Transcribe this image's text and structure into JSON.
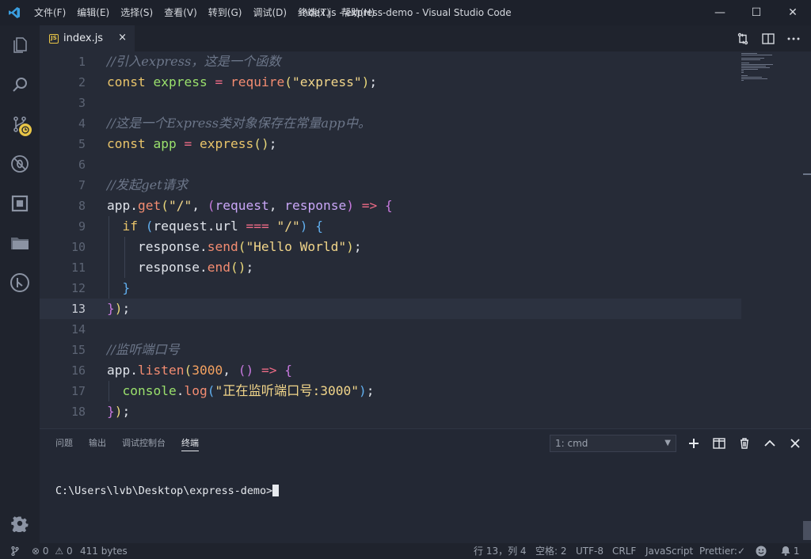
{
  "window": {
    "title": "index.js - express-demo - Visual Studio Code",
    "menu": [
      "文件(F)",
      "编辑(E)",
      "选择(S)",
      "查看(V)",
      "转到(G)",
      "调试(D)",
      "终端(T)",
      "帮助(H)"
    ],
    "controls": {
      "minimize": "—",
      "maximize": "☐",
      "close": "✕"
    }
  },
  "activity_bar": [
    "explorer-icon",
    "search-icon",
    "source-control-icon",
    "debug-icon",
    "extensions-icon",
    "folder-icon",
    "git-graph-icon",
    "gear-icon"
  ],
  "tab": {
    "badge": "JS",
    "label": "index.js",
    "close": "×"
  },
  "editor": {
    "current_line": 13,
    "lines": [
      {
        "n": "1",
        "tokens": [
          {
            "t": "//引入express，这是一个函数",
            "c": "c-comment"
          }
        ]
      },
      {
        "n": "2",
        "tokens": [
          {
            "t": "const",
            "c": "c-kw"
          },
          {
            "t": " ",
            "c": "c-plain"
          },
          {
            "t": "express",
            "c": "c-var"
          },
          {
            "t": " ",
            "c": "c-plain"
          },
          {
            "t": "=",
            "c": "c-op"
          },
          {
            "t": " ",
            "c": "c-plain"
          },
          {
            "t": "require",
            "c": "c-fn"
          },
          {
            "t": "(",
            "c": "c-paren"
          },
          {
            "t": "\"express\"",
            "c": "c-str"
          },
          {
            "t": ")",
            "c": "c-paren"
          },
          {
            "t": ";",
            "c": "c-plain"
          }
        ]
      },
      {
        "n": "3",
        "tokens": []
      },
      {
        "n": "4",
        "tokens": [
          {
            "t": "//这是一个Express类对象保存在常量app中。",
            "c": "c-comment"
          }
        ]
      },
      {
        "n": "5",
        "tokens": [
          {
            "t": "const",
            "c": "c-kw"
          },
          {
            "t": " ",
            "c": "c-plain"
          },
          {
            "t": "app",
            "c": "c-var"
          },
          {
            "t": " ",
            "c": "c-plain"
          },
          {
            "t": "=",
            "c": "c-op"
          },
          {
            "t": " ",
            "c": "c-plain"
          },
          {
            "t": "express",
            "c": "c-kw"
          },
          {
            "t": "()",
            "c": "c-paren"
          },
          {
            "t": ";",
            "c": "c-plain"
          }
        ]
      },
      {
        "n": "6",
        "tokens": []
      },
      {
        "n": "7",
        "tokens": [
          {
            "t": "//发起get请求",
            "c": "c-comment"
          }
        ]
      },
      {
        "n": "8",
        "tokens": [
          {
            "t": "app",
            "c": "c-plain"
          },
          {
            "t": ".",
            "c": "c-plain"
          },
          {
            "t": "get",
            "c": "c-fn"
          },
          {
            "t": "(",
            "c": "c-paren"
          },
          {
            "t": "\"/\"",
            "c": "c-str"
          },
          {
            "t": ", ",
            "c": "c-plain"
          },
          {
            "t": "(",
            "c": "c-paren2"
          },
          {
            "t": "request",
            "c": "c-param"
          },
          {
            "t": ", ",
            "c": "c-plain"
          },
          {
            "t": "response",
            "c": "c-param"
          },
          {
            "t": ")",
            "c": "c-paren2"
          },
          {
            "t": " ",
            "c": "c-plain"
          },
          {
            "t": "=>",
            "c": "c-op"
          },
          {
            "t": " ",
            "c": "c-plain"
          },
          {
            "t": "{",
            "c": "c-paren2"
          }
        ]
      },
      {
        "n": "9",
        "tokens": [
          {
            "t": "  ",
            "c": "c-plain"
          },
          {
            "t": "if",
            "c": "c-if"
          },
          {
            "t": " ",
            "c": "c-plain"
          },
          {
            "t": "(",
            "c": "c-paren3"
          },
          {
            "t": "request",
            "c": "c-plain"
          },
          {
            "t": ".url ",
            "c": "c-plain"
          },
          {
            "t": "===",
            "c": "c-op"
          },
          {
            "t": " ",
            "c": "c-plain"
          },
          {
            "t": "\"/\"",
            "c": "c-str"
          },
          {
            "t": ")",
            "c": "c-paren3"
          },
          {
            "t": " ",
            "c": "c-plain"
          },
          {
            "t": "{",
            "c": "c-paren3"
          }
        ]
      },
      {
        "n": "10",
        "tokens": [
          {
            "t": "    ",
            "c": "c-plain"
          },
          {
            "t": "response",
            "c": "c-plain"
          },
          {
            "t": ".",
            "c": "c-plain"
          },
          {
            "t": "send",
            "c": "c-fn"
          },
          {
            "t": "(",
            "c": "c-paren"
          },
          {
            "t": "\"Hello World\"",
            "c": "c-str"
          },
          {
            "t": ")",
            "c": "c-paren"
          },
          {
            "t": ";",
            "c": "c-plain"
          }
        ]
      },
      {
        "n": "11",
        "tokens": [
          {
            "t": "    ",
            "c": "c-plain"
          },
          {
            "t": "response",
            "c": "c-plain"
          },
          {
            "t": ".",
            "c": "c-plain"
          },
          {
            "t": "end",
            "c": "c-fn"
          },
          {
            "t": "()",
            "c": "c-paren"
          },
          {
            "t": ";",
            "c": "c-plain"
          }
        ]
      },
      {
        "n": "12",
        "tokens": [
          {
            "t": "  ",
            "c": "c-plain"
          },
          {
            "t": "}",
            "c": "c-paren3"
          }
        ]
      },
      {
        "n": "13",
        "tokens": [
          {
            "t": "}",
            "c": "c-paren2"
          },
          {
            "t": ")",
            "c": "c-paren"
          },
          {
            "t": ";",
            "c": "c-plain"
          }
        ]
      },
      {
        "n": "14",
        "tokens": []
      },
      {
        "n": "15",
        "tokens": [
          {
            "t": "//监听端口号",
            "c": "c-comment"
          }
        ]
      },
      {
        "n": "16",
        "tokens": [
          {
            "t": "app",
            "c": "c-plain"
          },
          {
            "t": ".",
            "c": "c-plain"
          },
          {
            "t": "listen",
            "c": "c-fn"
          },
          {
            "t": "(",
            "c": "c-paren"
          },
          {
            "t": "3000",
            "c": "c-num"
          },
          {
            "t": ", ",
            "c": "c-plain"
          },
          {
            "t": "()",
            "c": "c-paren2"
          },
          {
            "t": " ",
            "c": "c-plain"
          },
          {
            "t": "=>",
            "c": "c-op"
          },
          {
            "t": " ",
            "c": "c-plain"
          },
          {
            "t": "{",
            "c": "c-paren2"
          }
        ]
      },
      {
        "n": "17",
        "tokens": [
          {
            "t": "  ",
            "c": "c-plain"
          },
          {
            "t": "console",
            "c": "c-console"
          },
          {
            "t": ".",
            "c": "c-plain"
          },
          {
            "t": "log",
            "c": "c-fn"
          },
          {
            "t": "(",
            "c": "c-paren3"
          },
          {
            "t": "\"正在监听端口号:3000\"",
            "c": "c-str"
          },
          {
            "t": ")",
            "c": "c-paren3"
          },
          {
            "t": ";",
            "c": "c-plain"
          }
        ]
      },
      {
        "n": "18",
        "tokens": [
          {
            "t": "}",
            "c": "c-paren2"
          },
          {
            "t": ")",
            "c": "c-paren"
          },
          {
            "t": ";",
            "c": "c-plain"
          }
        ]
      }
    ]
  },
  "panel": {
    "tabs": [
      "问题",
      "输出",
      "调试控制台",
      "终端"
    ],
    "active_tab": 3,
    "terminal_select": "1: cmd",
    "actions": {
      "add": "+",
      "split": "◫",
      "trash": "🗑",
      "maximize": "∧",
      "close": "✕"
    },
    "terminal_text": "C:\\Users\\lvb\\Desktop\\express-demo>"
  },
  "status": {
    "errors": "0",
    "warnings": "0",
    "file_size": "411 bytes",
    "position": "行 13，列 4",
    "indent": "空格: 2",
    "encoding": "UTF-8",
    "eol": "CRLF",
    "language": "JavaScript",
    "prettier": "Prettier:",
    "notifications": "1"
  },
  "colors": {
    "accent_badge": "#e8c547",
    "background": "#262b37"
  }
}
